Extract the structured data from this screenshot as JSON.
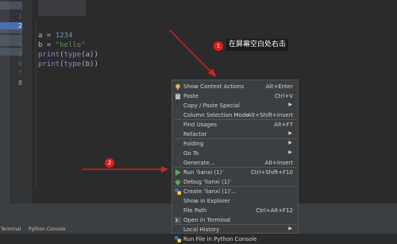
{
  "editor": {
    "line_numbers": [
      "1",
      "2",
      "3",
      "4",
      "5",
      "6",
      "7",
      "8"
    ],
    "code_lines": [
      {
        "parts": [
          {
            "t": "a = ",
            "c": "plain"
          },
          {
            "t": "1234",
            "c": "num"
          }
        ]
      },
      {
        "parts": [
          {
            "t": "b = ",
            "c": "plain"
          },
          {
            "t": "\"hello\"",
            "c": "str"
          }
        ]
      },
      {
        "parts": [
          {
            "t": "print",
            "c": "func"
          },
          {
            "t": "(",
            "c": "plain"
          },
          {
            "t": "type",
            "c": "func"
          },
          {
            "t": "(a))",
            "c": "plain"
          }
        ]
      },
      {
        "parts": [
          {
            "t": "print",
            "c": "func"
          },
          {
            "t": "(",
            "c": "plain"
          },
          {
            "t": "type",
            "c": "func"
          },
          {
            "t": "(b))",
            "c": "plain"
          }
        ]
      }
    ]
  },
  "annotations": {
    "badge1": "1",
    "tip1": "在屏幕空白处右击",
    "badge2": "2",
    "arrow_color": "#e01e1e"
  },
  "context_menu": {
    "items": [
      {
        "icon": "bulb-icon",
        "label": "Show Context Actions",
        "shortcut": "Alt+Enter",
        "submenu": false
      },
      {
        "icon": "paste-icon",
        "label": "Paste",
        "shortcut": "Ctrl+V",
        "submenu": false
      },
      {
        "icon": "",
        "label": "Copy / Paste Special",
        "shortcut": "",
        "submenu": true
      },
      {
        "icon": "",
        "label": "Column Selection Mode",
        "shortcut": "Alt+Shift+Insert",
        "submenu": false
      },
      {
        "icon": "",
        "label": "Find Usages",
        "shortcut": "Alt+F7",
        "submenu": false
      },
      {
        "icon": "",
        "label": "Refactor",
        "shortcut": "",
        "submenu": true
      },
      {
        "icon": "",
        "label": "Folding",
        "shortcut": "",
        "submenu": true
      },
      {
        "icon": "",
        "label": "Go To",
        "shortcut": "",
        "submenu": true
      },
      {
        "icon": "",
        "label": "Generate...",
        "shortcut": "Alt+Insert",
        "submenu": false
      },
      {
        "icon": "run-icon",
        "label": "Run 'lianxi (1)'",
        "shortcut": "Ctrl+Shift+F10",
        "submenu": false
      },
      {
        "icon": "debug-icon",
        "label": "Debug 'lianxi (1)'",
        "shortcut": "",
        "submenu": false
      },
      {
        "icon": "python-icon",
        "label": "Create 'lianxi (1)'...",
        "shortcut": "",
        "submenu": false
      },
      {
        "icon": "",
        "label": "Show in Explorer",
        "shortcut": "",
        "submenu": false
      },
      {
        "icon": "",
        "label": "File Path",
        "shortcut": "Ctrl+Alt+F12",
        "submenu": false
      },
      {
        "icon": "terminal-icon",
        "label": "Open in Terminal",
        "shortcut": "",
        "submenu": false
      },
      {
        "icon": "",
        "label": "Local History",
        "shortcut": "",
        "submenu": true
      },
      {
        "icon": "python-icon",
        "label": "Run File in Python Console",
        "shortcut": "",
        "submenu": false
      }
    ]
  },
  "status_bar": {
    "terminal": "Terminal",
    "python_console": "Python Console"
  },
  "colors": {
    "editor_bg": "#2b2b2b",
    "menu_bg": "#3c3f41",
    "accent": "#e01e1e"
  }
}
